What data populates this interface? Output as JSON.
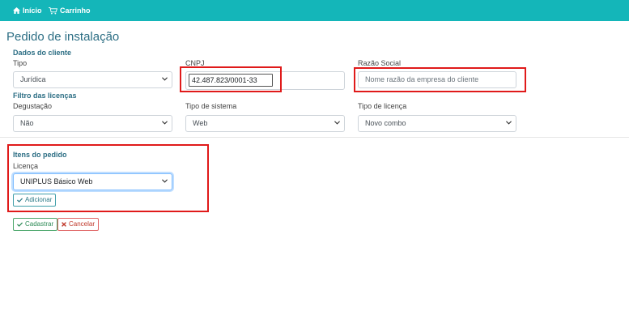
{
  "nav": {
    "home": "Início",
    "cart": "Carrinho"
  },
  "page": {
    "title": "Pedido de instalação"
  },
  "customer": {
    "section": "Dados do cliente",
    "type_label": "Tipo",
    "type_value": "Jurídica",
    "cnpj_label": "CNPJ",
    "cnpj_value": "42.487.823/0001-33",
    "company_label": "Razão Social",
    "company_placeholder": "Nome razão da empresa do cliente"
  },
  "filter": {
    "section": "Filtro das licenças",
    "trial_label": "Degustação",
    "trial_value": "Não",
    "system_label": "Tipo de sistema",
    "system_value": "Web",
    "license_type_label": "Tipo de licença",
    "license_type_value": "Novo combo"
  },
  "order": {
    "section": "Itens do pedido",
    "license_label": "Licença",
    "license_value": "UNIPLUS Básico Web",
    "add_label": "Adicionar"
  },
  "actions": {
    "save_label": "Cadastrar",
    "cancel_label": "Cancelar"
  },
  "colors": {
    "navbar": "#14b6b9",
    "heading": "#2c6e84",
    "highlight": "#e01a1a"
  }
}
